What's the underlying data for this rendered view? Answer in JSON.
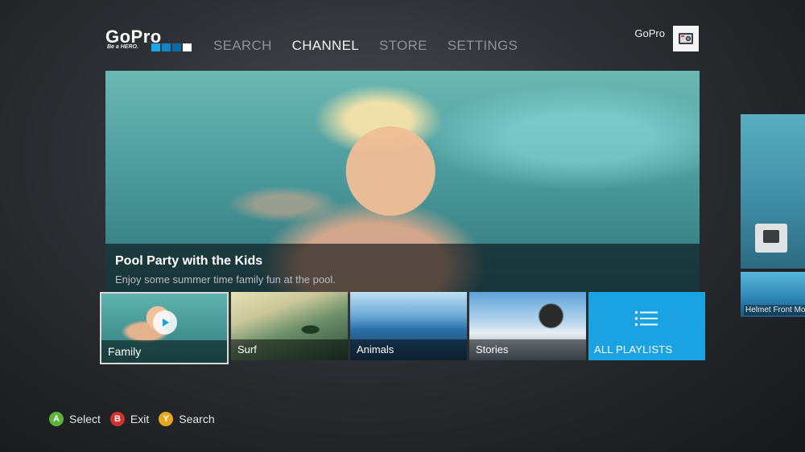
{
  "header": {
    "logo": {
      "word": "GoPro",
      "tagline": "Be a HERO."
    },
    "nav": [
      {
        "label": "SEARCH",
        "active": false
      },
      {
        "label": "CHANNEL",
        "active": true
      },
      {
        "label": "STORE",
        "active": false
      },
      {
        "label": "SETTINGS",
        "active": false
      }
    ],
    "account": {
      "name": "GoPro",
      "avatar_icon": "camera-icon"
    }
  },
  "featured": {
    "title": "Pool Party with the Kids",
    "description": "Enjoy some summer time family fun at the pool."
  },
  "playlists": [
    {
      "label": "Family",
      "selected": true,
      "icon": "play-icon"
    },
    {
      "label": "Surf",
      "selected": false
    },
    {
      "label": "Animals",
      "selected": false
    },
    {
      "label": "Stories",
      "selected": false
    },
    {
      "label": "ALL PLAYLISTS",
      "selected": false,
      "icon": "list-icon"
    }
  ],
  "next_card": {
    "label": "Helmet Front Mou"
  },
  "controls": [
    {
      "button": "A",
      "label": "Select",
      "color": "#5cb43a"
    },
    {
      "button": "B",
      "label": "Exit",
      "color": "#d2322d"
    },
    {
      "button": "Y",
      "label": "Search",
      "color": "#e8a81e"
    }
  ],
  "colors": {
    "accent": "#1aa2e2",
    "nav_inactive": "#8e9196",
    "nav_active": "#f2f2f2"
  }
}
